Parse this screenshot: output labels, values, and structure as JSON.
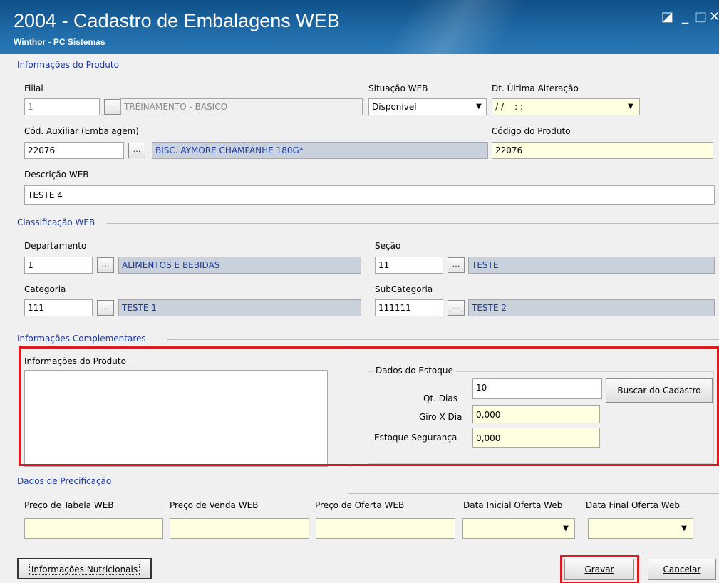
{
  "window": {
    "title": "2004 - Cadastro de Embalagens WEB",
    "subtitle": "Winthor - PC Sistemas"
  },
  "product_info": {
    "section_title": "Informações do Produto",
    "filial_label": "Filial",
    "filial_value": "1",
    "filial_desc": "TREINAMENTO - BASICO",
    "situacao_label": "Situação WEB",
    "situacao_value": "Disponível",
    "dt_label": "Dt. Última Alteração",
    "dt_value": "/ /    : :",
    "cod_aux_label": "Cód. Auxiliar (Embalagem)",
    "cod_aux_value": "22076",
    "cod_aux_desc": "BISC. AYMORE CHAMPANHE  180G*",
    "cod_prod_label": "Código do Produto",
    "cod_prod_value": "22076",
    "descricao_label": "Descrição WEB",
    "descricao_value": "TESTE 4"
  },
  "classificacao": {
    "section_title": "Classificação WEB",
    "departamento_label": "Departamento",
    "departamento_value": "1",
    "departamento_desc": "ALIMENTOS E BEBIDAS",
    "secao_label": "Seção",
    "secao_value": "11",
    "secao_desc": "TESTE",
    "categoria_label": "Categoria",
    "categoria_value": "111",
    "categoria_desc": "TESTE 1",
    "subcategoria_label": "SubCategoria",
    "subcategoria_value": "111111",
    "subcategoria_desc": "TESTE 2"
  },
  "complementares": {
    "section_title": "Informações Complementares",
    "info_produto_label": "Informações do Produto",
    "estoque_group": "Dados do Estoque",
    "qt_dias_label": "Qt. Dias",
    "qt_dias_value": "10",
    "giro_label": "Giro X Dia",
    "giro_value": "0,000",
    "estoque_seg_label": "Estoque Segurança",
    "estoque_seg_value": "0,000",
    "buscar_button": "Buscar do Cadastro"
  },
  "precificacao": {
    "section_title": "Dados de Precificação",
    "preco_tabela_label": "Preço de Tabela WEB",
    "preco_venda_label": "Preço de Venda WEB",
    "preco_oferta_label": "Preço de Oferta WEB",
    "data_inicial_label": "Data Inicial Oferta Web",
    "data_final_label": "Data Final Oferta Web"
  },
  "buttons": {
    "info_nutricionais": "Informações Nutricionais",
    "gravar": "Gravar",
    "cancelar": "Cancelar"
  },
  "icons": {
    "dots": "…",
    "dropdown": "▼",
    "restore": "◪",
    "minimize": "_",
    "maximize": "□",
    "close": "✕"
  },
  "colors": {
    "highlight": "#e0181f",
    "section_title": "#1b3aa0",
    "readonly_yellow": "#ffffe1"
  }
}
